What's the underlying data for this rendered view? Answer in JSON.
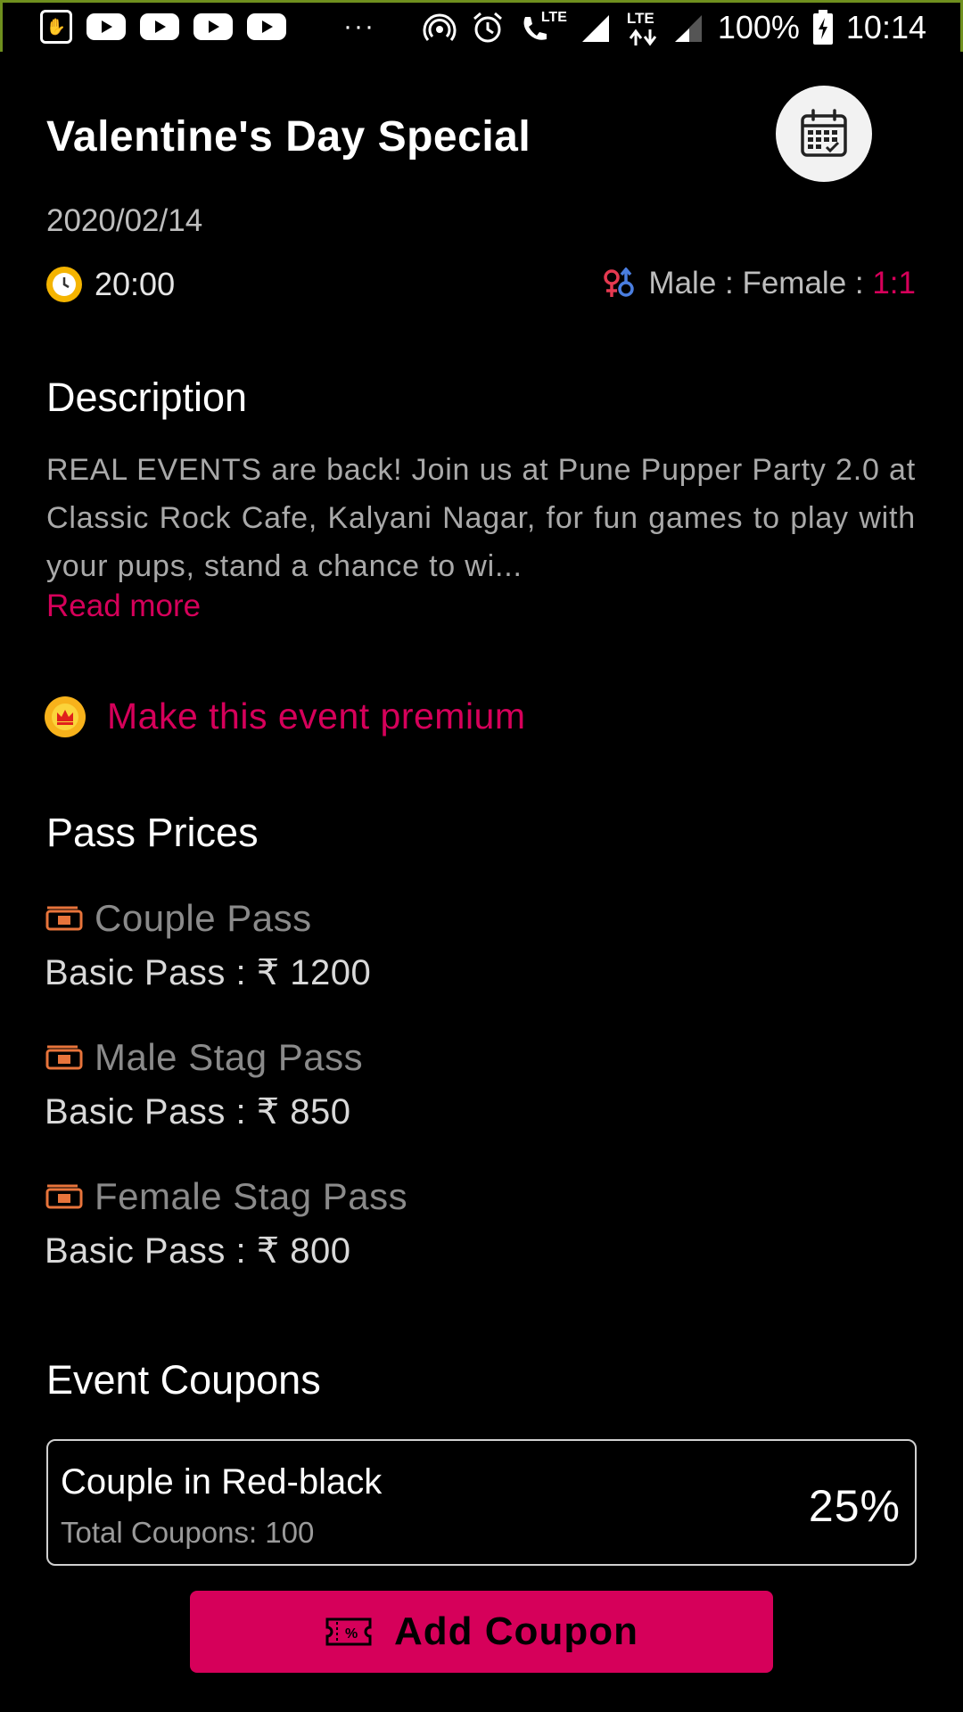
{
  "status_bar": {
    "lte_label_1": "LTE",
    "lte_label_2": "LTE",
    "battery": "100%",
    "time": "10:14",
    "more": "···"
  },
  "event": {
    "title": "Valentine's Day Special",
    "date": "2020/02/14",
    "time": "20:00",
    "ratio_label": "Male : Female : ",
    "ratio_value": "1:1"
  },
  "description": {
    "heading": "Description",
    "text": "REAL EVENTS are back! Join us at Pune Pupper Party 2.0 at Classic Rock Cafe, Kalyani Nagar, for fun games to play with your pups, stand a chance to wi...",
    "read_more": "Read more"
  },
  "premium": {
    "label": "Make this event premium"
  },
  "passes": {
    "heading": "Pass Prices",
    "items": [
      {
        "name": "Couple Pass",
        "price": "Basic Pass : ₹ 1200"
      },
      {
        "name": "Male Stag Pass",
        "price": "Basic Pass : ₹ 850"
      },
      {
        "name": "Female Stag Pass",
        "price": "Basic Pass : ₹ 800"
      }
    ]
  },
  "coupons": {
    "heading": "Event Coupons",
    "items": [
      {
        "name": "Couple in Red-black",
        "total": "Total Coupons: 100",
        "discount": "25%"
      }
    ],
    "add_button": "Add Coupon"
  },
  "colors": {
    "accent": "#d6005a",
    "background": "#000000",
    "ticket_icon": "#e8743b"
  }
}
